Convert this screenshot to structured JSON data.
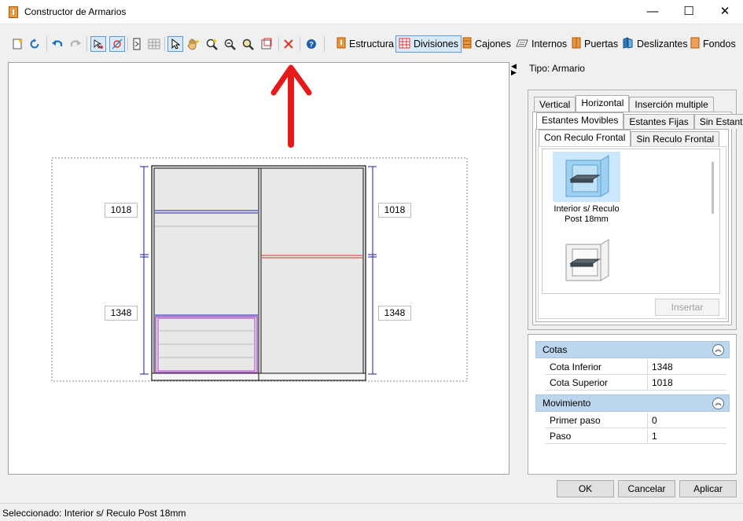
{
  "window": {
    "title": "Constructor de Armarios",
    "minimize": "—",
    "maximize": "☐",
    "close": "✕"
  },
  "toolbar": {
    "modes": [
      {
        "label": "Estructura",
        "color": "#e8973a"
      },
      {
        "label": "Divisiones",
        "color": "#d33a3a"
      },
      {
        "label": "Cajones",
        "color": "#e8973a"
      },
      {
        "label": "Internos",
        "color": "#7a7a7a"
      },
      {
        "label": "Puertas",
        "color": "#e8973a"
      },
      {
        "label": "Deslizantes",
        "color": "#2a7bbf"
      },
      {
        "label": "Fondos",
        "color": "#e8973a"
      }
    ]
  },
  "canvas": {
    "dims": {
      "left_top": "1018",
      "left_bottom": "1348",
      "right_top": "1018",
      "right_bottom": "1348"
    }
  },
  "panel": {
    "tipo": "Tipo: Armario",
    "tabs_level1": [
      "Vertical",
      "Horizontal",
      "Inserción multiple"
    ],
    "tabs_level2": [
      "Estantes Movibles",
      "Estantes Fijas",
      "Sin Estante"
    ],
    "tabs_level3": [
      "Con Reculo Frontal",
      "Sin Reculo Frontal"
    ],
    "gallery": [
      {
        "label": "Interior s/ Reculo Post 18mm",
        "selected": true
      }
    ],
    "insert_button": "Insertar"
  },
  "properties": {
    "section1": {
      "title": "Cotas",
      "rows": [
        {
          "key": "Cota Inferior",
          "value": "1348"
        },
        {
          "key": "Cota Superior",
          "value": "1018"
        }
      ]
    },
    "section2": {
      "title": "Movimiento",
      "rows": [
        {
          "key": "Primer paso",
          "value": "0"
        },
        {
          "key": "Paso",
          "value": "1"
        }
      ]
    }
  },
  "buttons": {
    "ok": "OK",
    "cancel": "Cancelar",
    "apply": "Aplicar"
  },
  "status": {
    "text": "Seleccionado: Interior s/ Reculo Post 18mm"
  },
  "colors": {
    "division_selected": "#e0322d",
    "division_blue": "#1c1ca8",
    "drawers": "#a040c0",
    "annotation_arrow": "#e51b1b"
  }
}
